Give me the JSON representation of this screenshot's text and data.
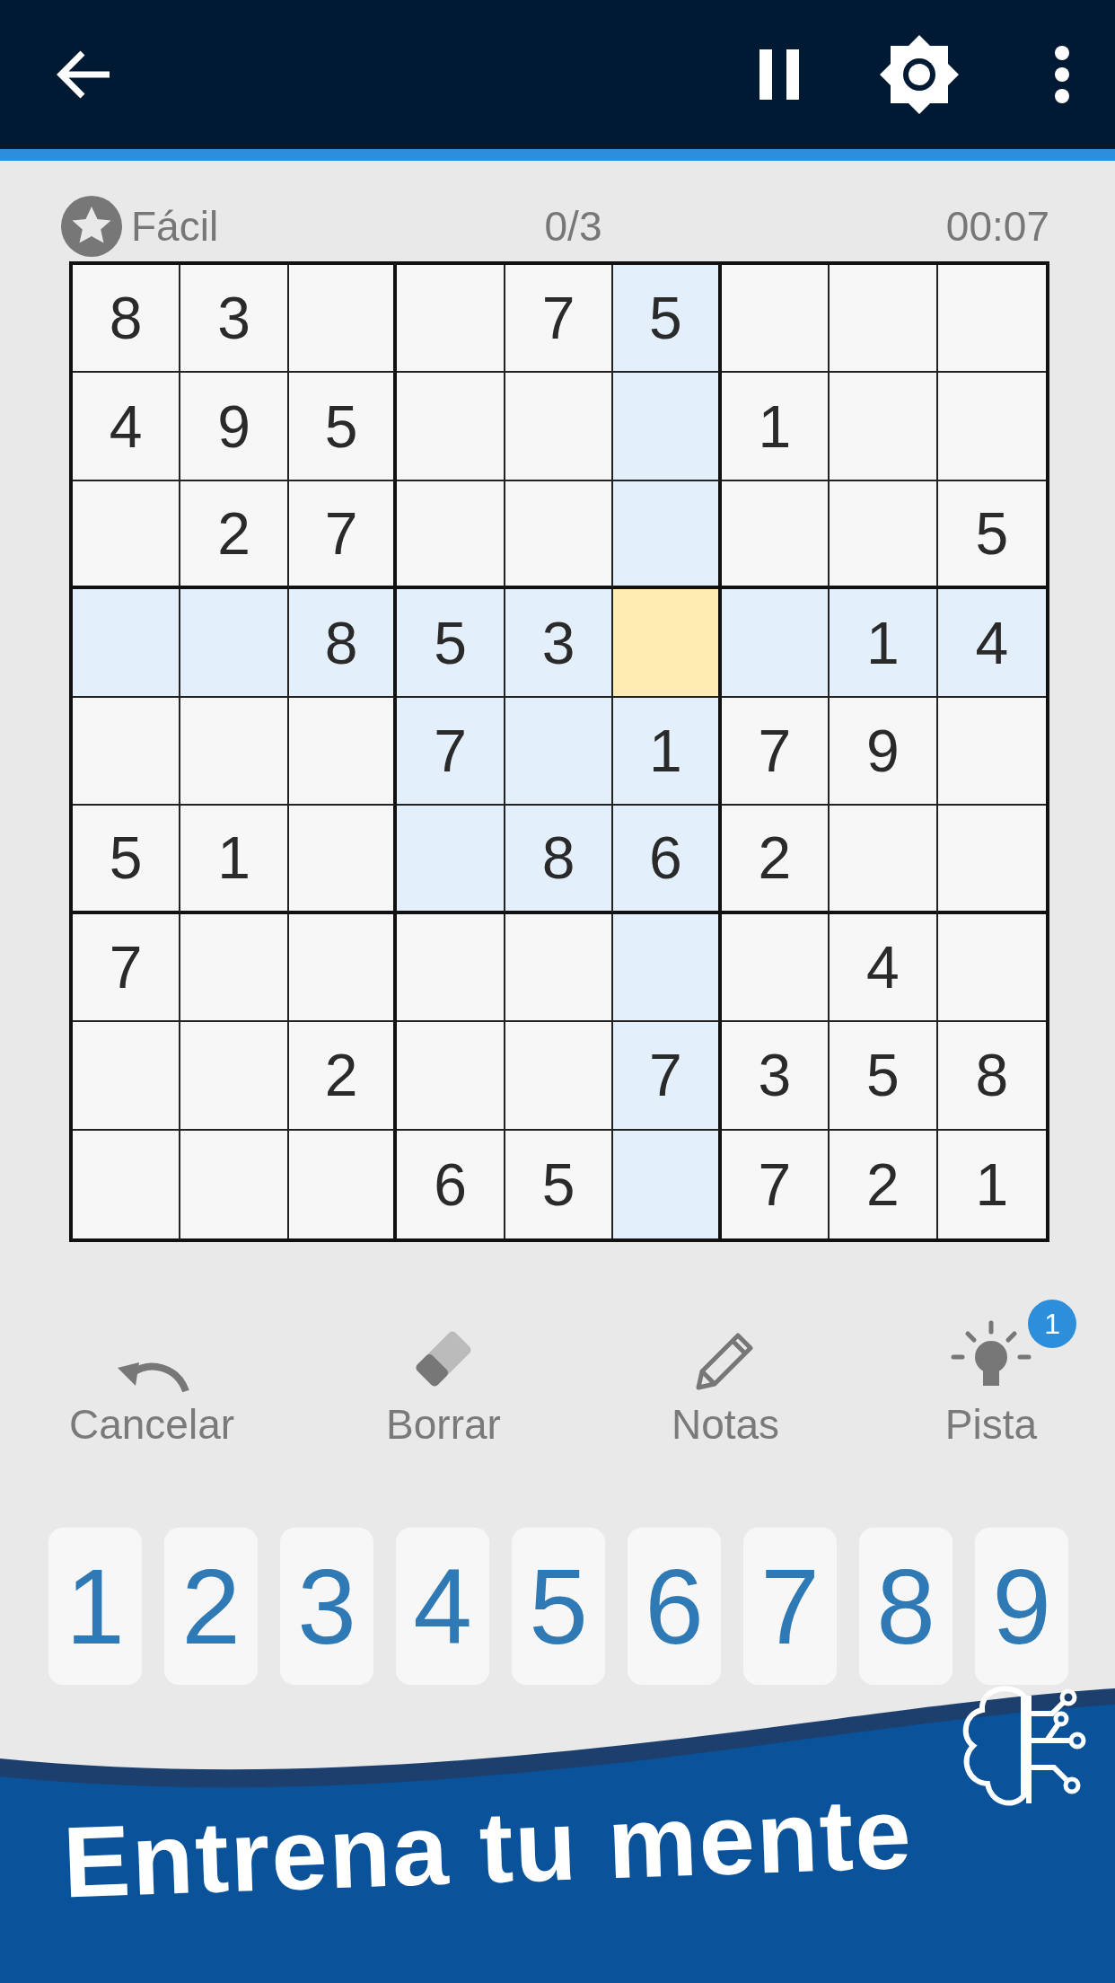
{
  "status": {
    "difficulty": "Fácil",
    "mistakes": "0/3",
    "timer": "00:07"
  },
  "grid": [
    [
      {
        "value": "8",
        "selected": false
      },
      {
        "value": "3",
        "selected": false
      },
      {
        "selected": false
      },
      {
        "selected": false
      },
      {
        "value": "7",
        "selected": false
      },
      {
        "value": "5",
        "selected": false
      },
      {
        "selected": false
      },
      {
        "selected": false
      },
      {
        "selected": false
      }
    ],
    [
      {
        "value": "4",
        "selected": false
      },
      {
        "value": "9",
        "selected": false
      },
      {
        "value": "5",
        "selected": false
      },
      {
        "selected": false
      },
      {
        "selected": false
      },
      {
        "selected": false
      },
      {
        "value": "1",
        "selected": false
      },
      {
        "selected": false
      },
      {
        "selected": false
      }
    ],
    [
      {
        "selected": false
      },
      {
        "value": "2",
        "selected": false
      },
      {
        "value": "7",
        "selected": false
      },
      {
        "selected": false
      },
      {
        "selected": false
      },
      {
        "selected": false
      },
      {
        "selected": false
      },
      {
        "selected": false
      },
      {
        "value": "5",
        "selected": false
      }
    ],
    [
      {
        "selected": false
      },
      {
        "selected": false
      },
      {
        "value": "8",
        "selected": false
      },
      {
        "value": "5",
        "selected": false
      },
      {
        "value": "3",
        "selected": false
      },
      {
        "selected": true
      },
      {
        "selected": false
      },
      {
        "value": "1",
        "selected": false
      },
      {
        "value": "4",
        "selected": false
      }
    ],
    [
      {
        "selected": false
      },
      {
        "selected": false
      },
      {
        "selected": false
      },
      {
        "value": "7",
        "selected": false
      },
      {
        "selected": false
      },
      {
        "value": "1",
        "selected": false
      },
      {
        "value": "7",
        "selected": false
      },
      {
        "value": "9",
        "selected": false
      },
      {
        "selected": false
      }
    ],
    [
      {
        "value": "5",
        "selected": false
      },
      {
        "value": "1",
        "selected": false
      },
      {
        "selected": false
      },
      {
        "selected": false
      },
      {
        "value": "8",
        "selected": false
      },
      {
        "value": "6",
        "selected": false
      },
      {
        "value": "2",
        "selected": false
      },
      {
        "selected": false
      },
      {
        "selected": false
      }
    ],
    [
      {
        "value": "7",
        "selected": false
      },
      {
        "selected": false
      },
      {
        "selected": false
      },
      {
        "selected": false
      },
      {
        "selected": false
      },
      {
        "selected": false
      },
      {
        "selected": false
      },
      {
        "value": "4",
        "selected": false
      },
      {
        "selected": false
      }
    ],
    [
      {
        "selected": false
      },
      {
        "selected": false
      },
      {
        "value": "2",
        "selected": false
      },
      {
        "selected": false
      },
      {
        "selected": false
      },
      {
        "value": "7",
        "selected": false
      },
      {
        "value": "3",
        "selected": false
      },
      {
        "value": "5",
        "selected": false
      },
      {
        "value": "8",
        "selected": false
      }
    ],
    [
      {
        "selected": false
      },
      {
        "selected": false
      },
      {
        "selected": false
      },
      {
        "value": "6",
        "selected": false
      },
      {
        "value": "5",
        "selected": false
      },
      {
        "selected": false
      },
      {
        "value": "7",
        "selected": false
      },
      {
        "value": "2",
        "selected": false
      },
      {
        "value": "1",
        "selected": false
      }
    ]
  ],
  "tools": [
    {
      "kind": "undo",
      "label": "Cancelar"
    },
    {
      "kind": "erase",
      "label": "Borrar"
    },
    {
      "kind": "notes",
      "label": "Notas"
    },
    {
      "kind": "hint",
      "label": "Pista",
      "badge": "1"
    }
  ],
  "numpad": [
    "1",
    "2",
    "3",
    "4",
    "5",
    "6",
    "7",
    "8",
    "9"
  ],
  "banner": {
    "title": "Entrena tu mente"
  }
}
